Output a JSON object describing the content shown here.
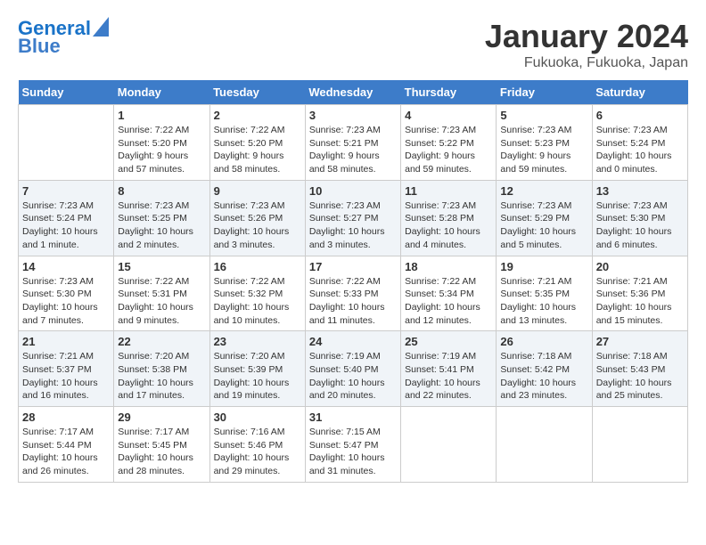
{
  "header": {
    "logo_line1": "General",
    "logo_line2": "Blue",
    "title": "January 2024",
    "subtitle": "Fukuoka, Fukuoka, Japan"
  },
  "columns": [
    "Sunday",
    "Monday",
    "Tuesday",
    "Wednesday",
    "Thursday",
    "Friday",
    "Saturday"
  ],
  "weeks": [
    [
      {
        "day": "",
        "info": ""
      },
      {
        "day": "1",
        "info": "Sunrise: 7:22 AM\nSunset: 5:20 PM\nDaylight: 9 hours\nand 57 minutes."
      },
      {
        "day": "2",
        "info": "Sunrise: 7:22 AM\nSunset: 5:20 PM\nDaylight: 9 hours\nand 58 minutes."
      },
      {
        "day": "3",
        "info": "Sunrise: 7:23 AM\nSunset: 5:21 PM\nDaylight: 9 hours\nand 58 minutes."
      },
      {
        "day": "4",
        "info": "Sunrise: 7:23 AM\nSunset: 5:22 PM\nDaylight: 9 hours\nand 59 minutes."
      },
      {
        "day": "5",
        "info": "Sunrise: 7:23 AM\nSunset: 5:23 PM\nDaylight: 9 hours\nand 59 minutes."
      },
      {
        "day": "6",
        "info": "Sunrise: 7:23 AM\nSunset: 5:24 PM\nDaylight: 10 hours\nand 0 minutes."
      }
    ],
    [
      {
        "day": "7",
        "info": "Sunrise: 7:23 AM\nSunset: 5:24 PM\nDaylight: 10 hours\nand 1 minute."
      },
      {
        "day": "8",
        "info": "Sunrise: 7:23 AM\nSunset: 5:25 PM\nDaylight: 10 hours\nand 2 minutes."
      },
      {
        "day": "9",
        "info": "Sunrise: 7:23 AM\nSunset: 5:26 PM\nDaylight: 10 hours\nand 3 minutes."
      },
      {
        "day": "10",
        "info": "Sunrise: 7:23 AM\nSunset: 5:27 PM\nDaylight: 10 hours\nand 3 minutes."
      },
      {
        "day": "11",
        "info": "Sunrise: 7:23 AM\nSunset: 5:28 PM\nDaylight: 10 hours\nand 4 minutes."
      },
      {
        "day": "12",
        "info": "Sunrise: 7:23 AM\nSunset: 5:29 PM\nDaylight: 10 hours\nand 5 minutes."
      },
      {
        "day": "13",
        "info": "Sunrise: 7:23 AM\nSunset: 5:30 PM\nDaylight: 10 hours\nand 6 minutes."
      }
    ],
    [
      {
        "day": "14",
        "info": "Sunrise: 7:23 AM\nSunset: 5:30 PM\nDaylight: 10 hours\nand 7 minutes."
      },
      {
        "day": "15",
        "info": "Sunrise: 7:22 AM\nSunset: 5:31 PM\nDaylight: 10 hours\nand 9 minutes."
      },
      {
        "day": "16",
        "info": "Sunrise: 7:22 AM\nSunset: 5:32 PM\nDaylight: 10 hours\nand 10 minutes."
      },
      {
        "day": "17",
        "info": "Sunrise: 7:22 AM\nSunset: 5:33 PM\nDaylight: 10 hours\nand 11 minutes."
      },
      {
        "day": "18",
        "info": "Sunrise: 7:22 AM\nSunset: 5:34 PM\nDaylight: 10 hours\nand 12 minutes."
      },
      {
        "day": "19",
        "info": "Sunrise: 7:21 AM\nSunset: 5:35 PM\nDaylight: 10 hours\nand 13 minutes."
      },
      {
        "day": "20",
        "info": "Sunrise: 7:21 AM\nSunset: 5:36 PM\nDaylight: 10 hours\nand 15 minutes."
      }
    ],
    [
      {
        "day": "21",
        "info": "Sunrise: 7:21 AM\nSunset: 5:37 PM\nDaylight: 10 hours\nand 16 minutes."
      },
      {
        "day": "22",
        "info": "Sunrise: 7:20 AM\nSunset: 5:38 PM\nDaylight: 10 hours\nand 17 minutes."
      },
      {
        "day": "23",
        "info": "Sunrise: 7:20 AM\nSunset: 5:39 PM\nDaylight: 10 hours\nand 19 minutes."
      },
      {
        "day": "24",
        "info": "Sunrise: 7:19 AM\nSunset: 5:40 PM\nDaylight: 10 hours\nand 20 minutes."
      },
      {
        "day": "25",
        "info": "Sunrise: 7:19 AM\nSunset: 5:41 PM\nDaylight: 10 hours\nand 22 minutes."
      },
      {
        "day": "26",
        "info": "Sunrise: 7:18 AM\nSunset: 5:42 PM\nDaylight: 10 hours\nand 23 minutes."
      },
      {
        "day": "27",
        "info": "Sunrise: 7:18 AM\nSunset: 5:43 PM\nDaylight: 10 hours\nand 25 minutes."
      }
    ],
    [
      {
        "day": "28",
        "info": "Sunrise: 7:17 AM\nSunset: 5:44 PM\nDaylight: 10 hours\nand 26 minutes."
      },
      {
        "day": "29",
        "info": "Sunrise: 7:17 AM\nSunset: 5:45 PM\nDaylight: 10 hours\nand 28 minutes."
      },
      {
        "day": "30",
        "info": "Sunrise: 7:16 AM\nSunset: 5:46 PM\nDaylight: 10 hours\nand 29 minutes."
      },
      {
        "day": "31",
        "info": "Sunrise: 7:15 AM\nSunset: 5:47 PM\nDaylight: 10 hours\nand 31 minutes."
      },
      {
        "day": "",
        "info": ""
      },
      {
        "day": "",
        "info": ""
      },
      {
        "day": "",
        "info": ""
      }
    ]
  ]
}
